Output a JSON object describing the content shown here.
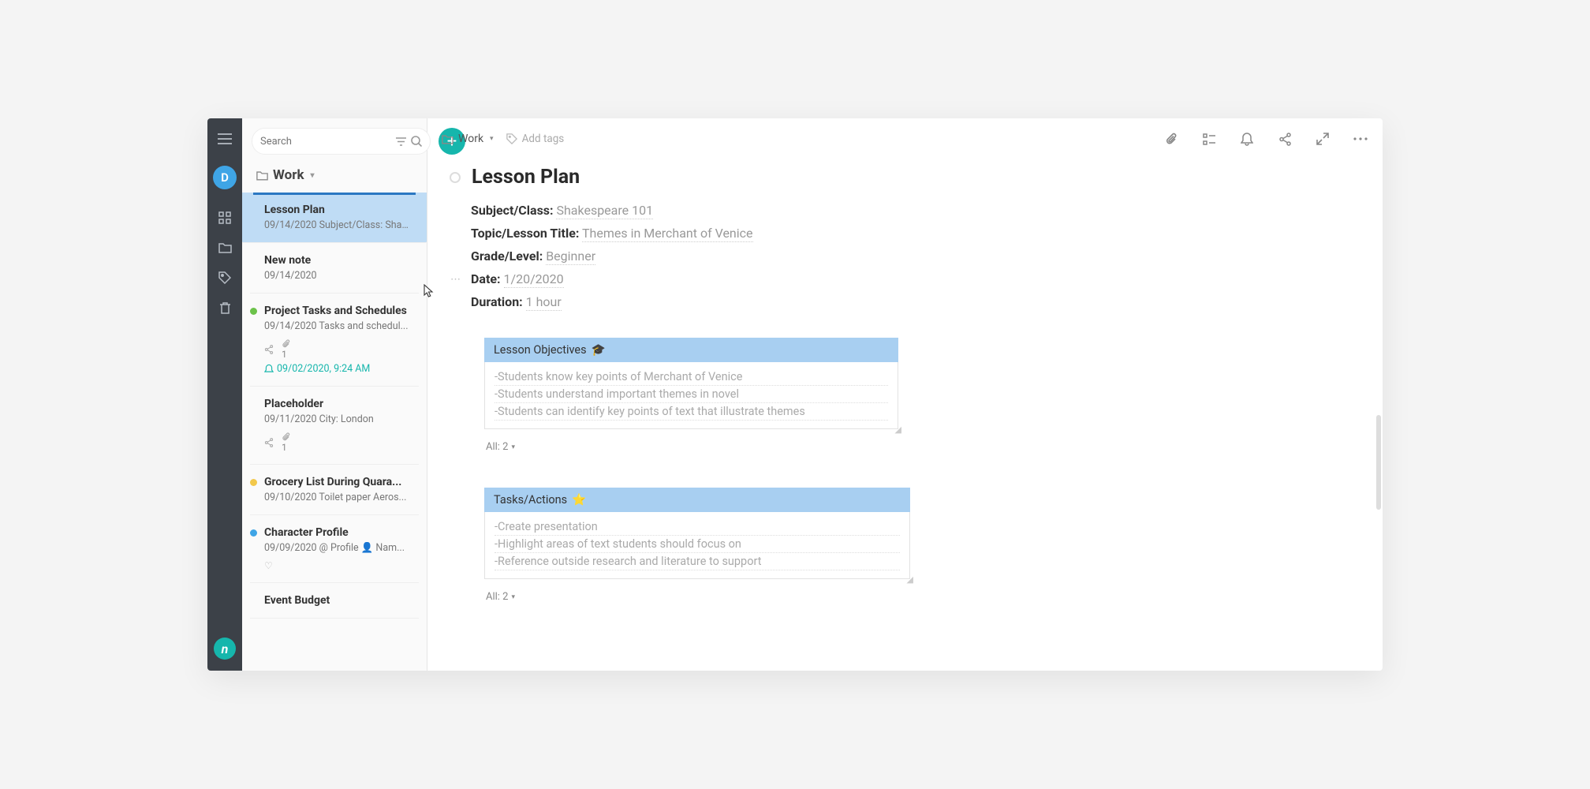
{
  "rail": {
    "avatar_letter": "D"
  },
  "search": {
    "placeholder": "Search"
  },
  "folder": {
    "name": "Work"
  },
  "notes": [
    {
      "id": "lesson-plan",
      "dot": null,
      "title": "Lesson Plan",
      "preview": "09/14/2020 Subject/Class: Sha...",
      "selected": true
    },
    {
      "id": "new-note",
      "dot": null,
      "title": "New note",
      "preview": "09/14/2020"
    },
    {
      "id": "project-tasks",
      "dot": "#6cc24a",
      "title": "Project Tasks and Schedules",
      "preview": "09/14/2020 Tasks and schedul...",
      "attachment": "1",
      "reminder": "09/02/2020, 9:24 AM"
    },
    {
      "id": "placeholder",
      "dot": null,
      "title": "Placeholder",
      "preview": "09/11/2020 City: London",
      "attachment": "1",
      "shared": true
    },
    {
      "id": "grocery",
      "dot": "#f2c84b",
      "title": "Grocery List During Quara...",
      "preview": "09/10/2020 Toilet paper Aeros..."
    },
    {
      "id": "character",
      "dot": "#3fa5e6",
      "title": "Character Profile",
      "preview": "09/09/2020 @ Profile 👤 Nam...",
      "heart": true
    },
    {
      "id": "event-budget",
      "dot": null,
      "title": "Event Budget"
    }
  ],
  "crumb": {
    "label": "Work"
  },
  "addtags": {
    "label": "Add tags"
  },
  "note": {
    "title": "Lesson Plan",
    "meta": {
      "subject_label": "Subject/Class:",
      "subject_val": "Shakespeare 101",
      "topic_label": "Topic/Lesson Title:",
      "topic_val": "Themes in Merchant of Venice",
      "grade_label": "Grade/Level:",
      "grade_val": "Beginner",
      "date_label": "Date:",
      "date_val": "1/20/2020",
      "duration_label": "Duration:",
      "duration_val": "1 hour"
    },
    "blocks": [
      {
        "title": "Lesson Objectives",
        "emoji": "🎓",
        "items": [
          "-Students know key points of Merchant of Venice",
          "-Students understand important themes in novel",
          "-Students can identify key points of text that illustrate themes"
        ],
        "footer": "All: 2"
      },
      {
        "title": "Tasks/Actions",
        "emoji": "⭐",
        "items": [
          "-Create presentation",
          "-Highlight areas of text students should focus on",
          "-Reference outside research and literature to support"
        ],
        "footer": "All: 2"
      }
    ]
  }
}
